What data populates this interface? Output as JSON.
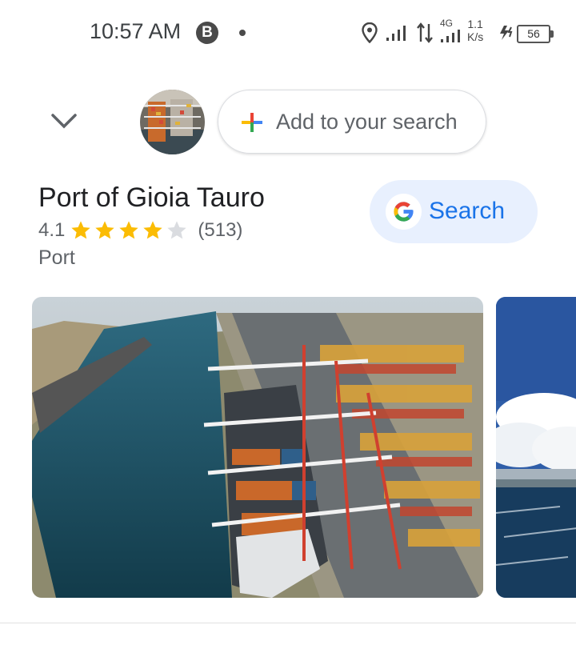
{
  "status_bar": {
    "time": "10:57 AM",
    "badge": "B",
    "network": "4G",
    "speed_value": "1.1",
    "speed_unit": "K/s",
    "battery": "56",
    "icons": [
      "location-icon",
      "signal-icon",
      "data-arrows-icon",
      "signal-4g-icon",
      "charging-icon",
      "battery-icon"
    ]
  },
  "search_bar": {
    "collapse_icon": "chevron-down-icon",
    "add_label": "Add to your search",
    "add_icon": "plus-icon"
  },
  "place": {
    "name": "Port of Gioia Tauro",
    "rating": "4.1",
    "stars_filled": 4,
    "stars_total": 5,
    "reviews": "(513)",
    "category": "Port"
  },
  "search_button": {
    "label": "Search",
    "icon": "google-g-icon"
  },
  "colors": {
    "accent": "#1a73e8",
    "chip_bg": "#e8f0fe",
    "star": "#fbbc04",
    "star_empty": "#dadce0"
  }
}
